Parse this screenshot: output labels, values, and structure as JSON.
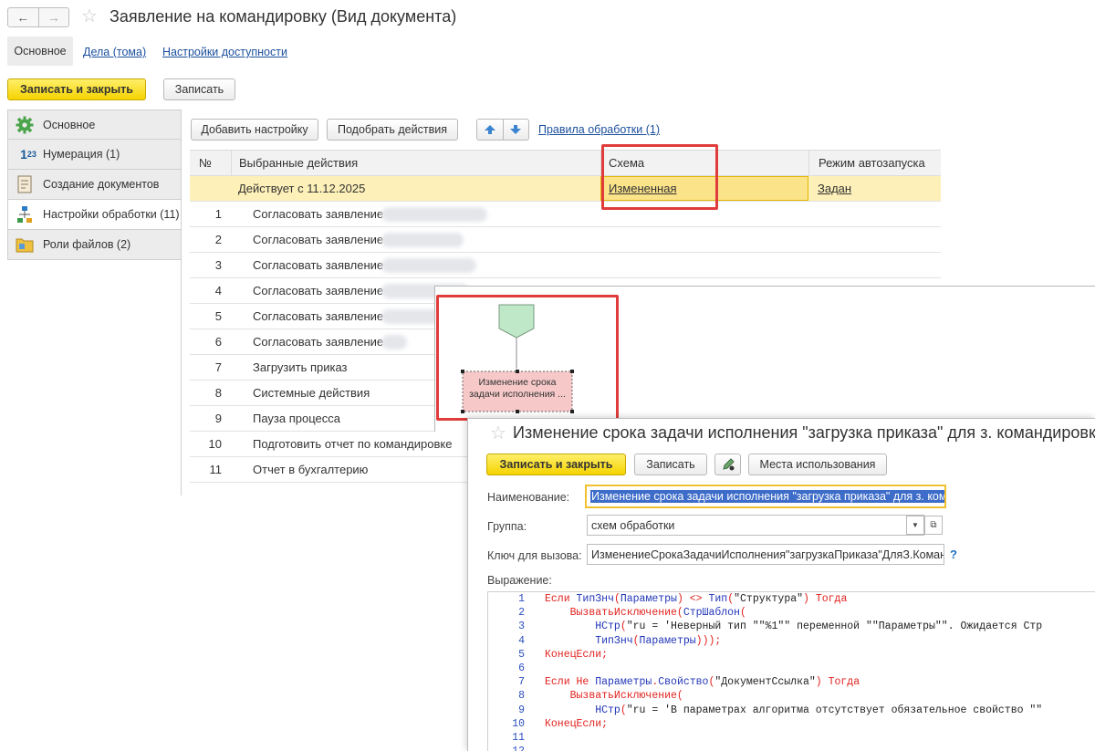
{
  "main_window": {
    "title": "Заявление на командировку (Вид документа)",
    "tabs": [
      {
        "label": "Основное",
        "active": true
      },
      {
        "label": "Дела (тома)",
        "active": false
      },
      {
        "label": "Настройки доступности",
        "active": false
      }
    ],
    "toolbar": {
      "save_close_label": "Записать и закрыть",
      "save_label": "Записать"
    },
    "sidebar": [
      {
        "label": "Основное",
        "icon": "gear-icon",
        "active": false
      },
      {
        "label": "Нумерация (1)",
        "icon": "numbering-icon",
        "active": false
      },
      {
        "label": "Создание документов",
        "icon": "document-icon",
        "active": false
      },
      {
        "label": "Настройки обработки (11)",
        "icon": "process-icon",
        "active": true
      },
      {
        "label": "Роли файлов (2)",
        "icon": "folder-icon",
        "active": false
      }
    ],
    "settings_toolbar": {
      "add_label": "Добавить настройку",
      "pick_label": "Подобрать действия",
      "rules_link": "Правила обработки (1)"
    },
    "table": {
      "headers": {
        "num": "№",
        "actions": "Выбранные действия",
        "schema": "Схема",
        "mode": "Режим автозапуска"
      },
      "selected_row": {
        "action": "Действует с 11.12.2025",
        "schema": "Измененная",
        "mode": "Задан"
      },
      "rows": [
        {
          "num": "1",
          "action": "Согласовать заявление"
        },
        {
          "num": "2",
          "action": "Согласовать заявление"
        },
        {
          "num": "3",
          "action": "Согласовать заявление"
        },
        {
          "num": "4",
          "action": "Согласовать заявление"
        },
        {
          "num": "5",
          "action": "Согласовать заявление"
        },
        {
          "num": "6",
          "action": "Согласовать заявление"
        },
        {
          "num": "7",
          "action": "Загрузить приказ"
        },
        {
          "num": "8",
          "action": "Системные действия"
        },
        {
          "num": "9",
          "action": "Пауза процесса"
        },
        {
          "num": "10",
          "action": "Подготовить отчет по командировке"
        },
        {
          "num": "11",
          "action": "Отчет в бухгалтерию"
        }
      ]
    }
  },
  "schema_view": {
    "block_text_line1": "Изменение срока",
    "block_text_line2": "задачи исполнения ..."
  },
  "second_window": {
    "title": "Изменение срока задачи исполнения \"загрузка приказа\" для з. командировку",
    "toolbar": {
      "save_close_label": "Записать и закрыть",
      "save_label": "Записать",
      "usage_label": "Места использования"
    },
    "fields": {
      "name_label": "Наименование:",
      "name_value": "Изменение срока задачи исполнения \"загрузка приказа\" для з. ком",
      "group_label": "Группа:",
      "group_value": "схем обработки",
      "key_label": "Ключ для вызова:",
      "key_value": "ИзменениеСрокаЗадачиИсполнения\"загрузкаПриказа\"ДляЗ.Коман,",
      "help": "?",
      "expr_label": "Выражение:"
    },
    "code_lines": [
      "1",
      "2",
      "3",
      "4",
      "5",
      "6",
      "7",
      "8",
      "9",
      "10",
      "11",
      "12"
    ],
    "colors": {
      "accent_yellow": "#f5d300",
      "highlight_red": "#e03c3c",
      "link_blue": "#1b4f9c"
    }
  }
}
